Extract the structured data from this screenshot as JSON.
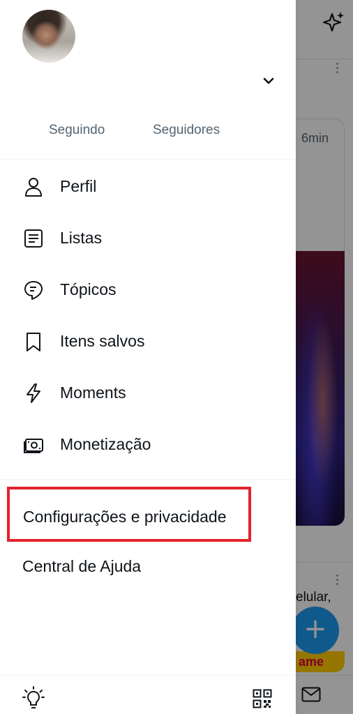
{
  "drawer": {
    "avatar_icon": "profile-photo",
    "follow": {
      "following_label": "Seguindo",
      "followers_label": "Seguidores"
    },
    "menu": [
      {
        "label": "Perfil",
        "icon": "person-icon"
      },
      {
        "label": "Listas",
        "icon": "list-icon"
      },
      {
        "label": "Tópicos",
        "icon": "topics-icon"
      },
      {
        "label": "Itens salvos",
        "icon": "bookmark-icon"
      },
      {
        "label": "Moments",
        "icon": "lightning-icon"
      },
      {
        "label": "Monetização",
        "icon": "money-icon"
      }
    ],
    "settings_label": "Configurações e privacidade",
    "help_label": "Central de Ajuda",
    "highlight_color": "#e2232a"
  },
  "feed": {
    "time": "6min",
    "tweet_text_fragment": "elular,",
    "ame_badge": "ame",
    "fab_symbol": "+"
  },
  "colors": {
    "accent": "#1d9bf0",
    "text_primary": "#0f1419",
    "text_secondary": "#536471"
  }
}
